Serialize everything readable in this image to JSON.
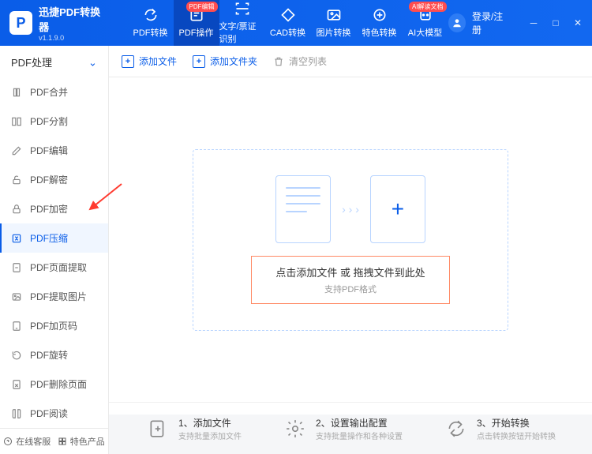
{
  "app": {
    "name": "迅捷PDF转换器",
    "version": "v1.1.9.0"
  },
  "nav": {
    "tabs": [
      {
        "label": "PDF转换",
        "badge": ""
      },
      {
        "label": "PDF操作",
        "badge": "PDF编辑"
      },
      {
        "label": "文字/票证识别",
        "badge": ""
      },
      {
        "label": "CAD转换",
        "badge": ""
      },
      {
        "label": "图片转换",
        "badge": ""
      },
      {
        "label": "特色转换",
        "badge": ""
      },
      {
        "label": "AI大模型",
        "badge": "AI解读文档"
      }
    ],
    "login": "登录/注册"
  },
  "sidebar": {
    "header": "PDF处理",
    "items": [
      "PDF合并",
      "PDF分割",
      "PDF编辑",
      "PDF解密",
      "PDF加密",
      "PDF压缩",
      "PDF页面提取",
      "PDF提取图片",
      "PDF加页码",
      "PDF旋转",
      "PDF删除页面",
      "PDF阅读"
    ],
    "footer": {
      "support": "在线客服",
      "products": "特色产品"
    }
  },
  "toolbar": {
    "add_file": "添加文件",
    "add_folder": "添加文件夹",
    "clear": "清空列表"
  },
  "drop": {
    "title": "点击添加文件 或 拖拽文件到此处",
    "subtitle": "支持PDF格式"
  },
  "steps": [
    {
      "num": "1、",
      "title": "添加文件",
      "sub": "支持批量添加文件"
    },
    {
      "num": "2、",
      "title": "设置输出配置",
      "sub": "支持批量操作和各种设置"
    },
    {
      "num": "3、",
      "title": "开始转换",
      "sub": "点击转换按钮开始转换"
    }
  ]
}
